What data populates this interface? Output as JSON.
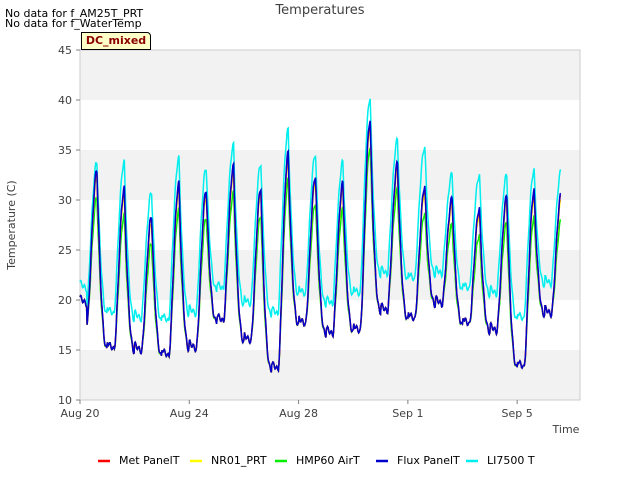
{
  "notes": [
    "No data for f_AM25T_PRT",
    "No data for f_WaterTemp"
  ],
  "badge": "DC_mixed",
  "chart_data": {
    "type": "line",
    "title": "Temperatures",
    "xlabel": "Time",
    "ylabel": "Temperature (C)",
    "ylim": [
      10,
      45
    ],
    "yticks": [
      10,
      15,
      20,
      25,
      30,
      35,
      40,
      45
    ],
    "xlim_days": [
      0,
      18.3
    ],
    "xticks": [
      {
        "day": 0,
        "label": "Aug 20"
      },
      {
        "day": 4,
        "label": "Aug 24"
      },
      {
        "day": 8,
        "label": "Aug 28"
      },
      {
        "day": 12,
        "label": "Sep 1"
      },
      {
        "day": 16,
        "label": "Sep 5"
      }
    ],
    "grid": "alternating horizontal bands",
    "legend_position": "bottom",
    "daily": {
      "days": [
        "Aug 20",
        "Aug 21",
        "Aug 22",
        "Aug 23",
        "Aug 24",
        "Aug 25",
        "Aug 26",
        "Aug 27",
        "Aug 28",
        "Aug 29",
        "Aug 30",
        "Aug 31",
        "Sep 1",
        "Sep 2",
        "Sep 3",
        "Sep 4",
        "Sep 5",
        "Sep 6"
      ],
      "min": [
        17.5,
        15.0,
        14.8,
        14.3,
        15.0,
        17.8,
        15.8,
        13.0,
        17.5,
        16.5,
        16.8,
        18.8,
        18.0,
        19.5,
        17.5,
        16.8,
        13.2,
        18.5
      ],
      "max": [
        32.8,
        31.0,
        28.2,
        31.5,
        30.8,
        33.2,
        31.0,
        34.5,
        32.2,
        31.5,
        37.8,
        33.5,
        31.2,
        30.0,
        29.0,
        30.2,
        30.8,
        30.5
      ],
      "li7500_min": [
        19.0,
        18.5,
        18.0,
        17.8,
        18.5,
        21.0,
        19.5,
        18.5,
        20.5,
        19.5,
        20.5,
        22.5,
        22.0,
        22.5,
        21.0,
        20.5,
        18.0,
        21.5
      ],
      "li7500_max": [
        33.8,
        33.8,
        30.8,
        34.2,
        33.2,
        35.5,
        33.6,
        37.0,
        34.6,
        33.8,
        40.2,
        36.0,
        35.3,
        32.6,
        32.5,
        32.5,
        33.0,
        33.0
      ]
    },
    "series": [
      {
        "name": "Met PanelT",
        "color": "#ff0000",
        "offset": 0
      },
      {
        "name": "NR01_PRT",
        "color": "#ffff00",
        "offset": -0.5
      },
      {
        "name": "HMP60 AirT",
        "color": "#00ee00",
        "offset": -2.5
      },
      {
        "name": "Flux PanelT",
        "color": "#0000cc",
        "offset": 0.2
      },
      {
        "name": "LI7500 T",
        "color": "#00eeee",
        "offset": 0
      }
    ]
  }
}
